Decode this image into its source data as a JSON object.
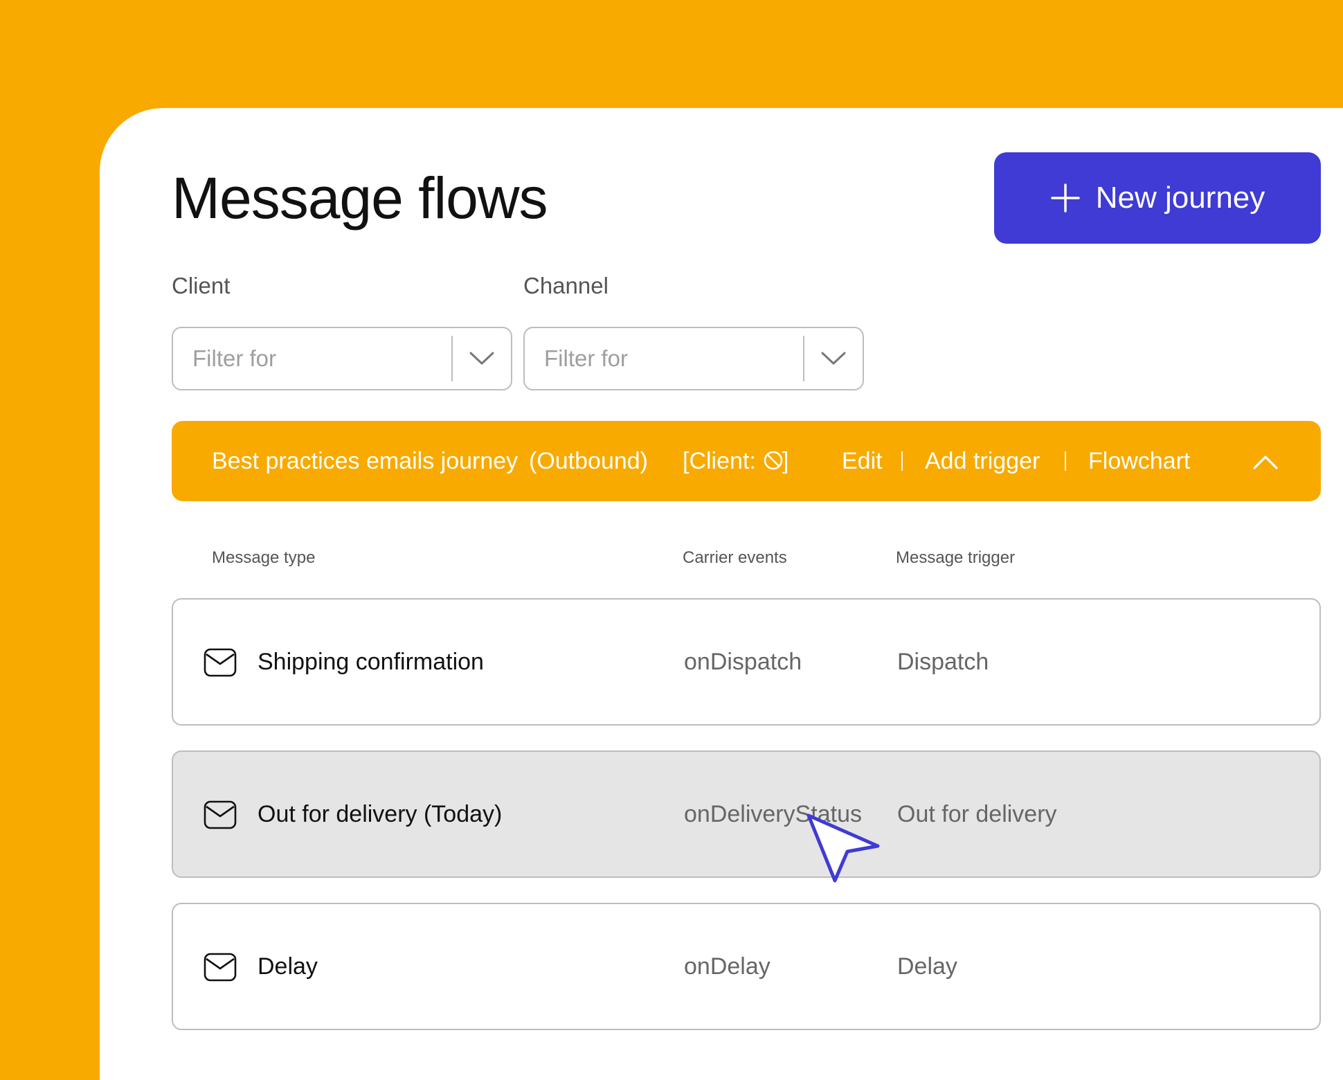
{
  "page": {
    "title": "Message flows",
    "new_button_label": "New journey"
  },
  "filters": {
    "client": {
      "label": "Client",
      "placeholder": "Filter for"
    },
    "channel": {
      "label": "Channel",
      "placeholder": "Filter for"
    }
  },
  "journey": {
    "name": "Best practices emails journey",
    "direction": "(Outbound)",
    "client_prefix": "[Client:",
    "client_suffix": "]",
    "actions": {
      "edit": "Edit",
      "add_trigger": "Add trigger",
      "flowchart": "Flowchart"
    }
  },
  "table": {
    "headers": {
      "message_type": "Message type",
      "carrier_events": "Carrier events",
      "message_trigger": "Message trigger"
    },
    "rows": [
      {
        "message_type": "Shipping confirmation",
        "carrier_event": "onDispatch",
        "trigger": "Dispatch",
        "icon": "envelope-icon"
      },
      {
        "message_type": "Out for delivery (Today)",
        "carrier_event": "onDeliveryStatus",
        "trigger": "Out for delivery",
        "icon": "envelope-icon",
        "highlighted": true
      },
      {
        "message_type": "Delay",
        "carrier_event": "onDelay",
        "trigger": "Delay",
        "icon": "envelope-icon"
      }
    ]
  },
  "colors": {
    "background": "#F9AA00",
    "primary": "#3F3BD4",
    "banner": "#F9AA00",
    "row_highlight": "#E5E5E5"
  }
}
